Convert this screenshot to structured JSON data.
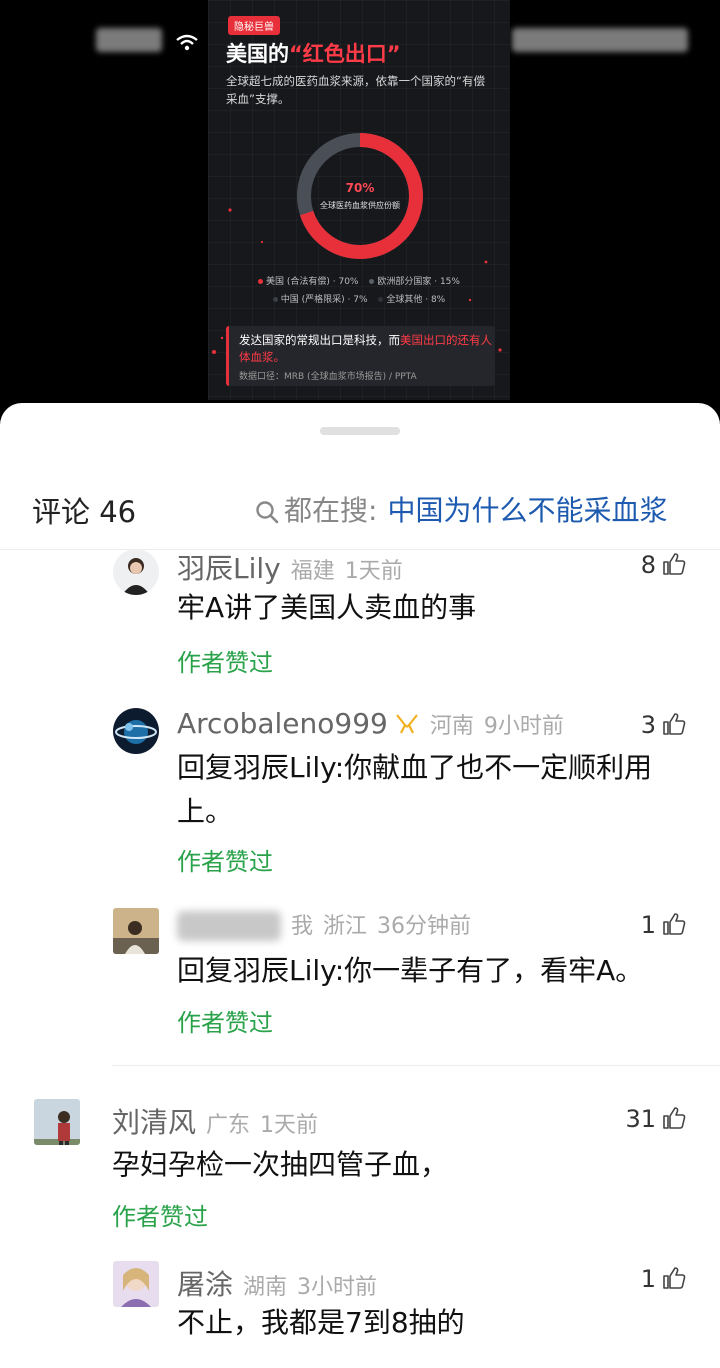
{
  "poster": {
    "tag": "隐秘巨兽",
    "title_plain": "美国的",
    "title_red": "“红色出口”",
    "subtitle": "全球超七成的医药血浆来源，依靠一个国家的“有偿采血”支撑。",
    "donut_value": "70%",
    "donut_label": "全球医药血浆供应份额",
    "share": [
      70,
      15,
      7,
      8
    ],
    "legend_row1": [
      {
        "text": "美国 (合法有偿) · 70%",
        "color": "#e8303a"
      },
      {
        "text": "欧洲部分国家 · 15%",
        "color": "#5a5f68"
      }
    ],
    "legend_row2": [
      {
        "text": "中国 (严格限采) · 7%",
        "color": "#3b3f46"
      },
      {
        "text": "全球其他 · 8%",
        "color": "#2e3137"
      }
    ],
    "note_text": "发达国家的常规出口是科技，而",
    "note_red": "美国出口的还有人体血浆。",
    "note_source": "数据口径：MRB (全球血浆市场报告) / PPTA",
    "colors": {
      "accent": "#e8303a",
      "ring_gray": "#4a4e56"
    }
  },
  "sheet": {
    "comments_label": "评论 46",
    "search_prefix": "都在搜:",
    "search_term": "中国为什么不能采血浆"
  },
  "comments": [
    {
      "user": "羽辰Lily",
      "location": "福建",
      "time": "1天前",
      "likes": "8",
      "text": "牢A讲了美国人卖血的事",
      "author_liked": "作者赞过"
    },
    {
      "user": "Arcobaleno999",
      "location": "河南",
      "time": "9小时前",
      "likes": "3",
      "text": "回复羽辰Lily:你献血了也不一定顺利用上。",
      "author_liked": "作者赞过"
    },
    {
      "user": "",
      "me_label": "我",
      "location": "浙江",
      "time": "36分钟前",
      "likes": "1",
      "text": "回复羽辰Lily:你一辈子有了，看牢A。",
      "author_liked": "作者赞过"
    },
    {
      "user": "刘清风",
      "location": "广东",
      "time": "1天前",
      "likes": "31",
      "text": "孕妇孕检一次抽四管子血，",
      "author_liked": "作者赞过"
    },
    {
      "user": "屠涂",
      "location": "湖南",
      "time": "3小时前",
      "likes": "1",
      "text": "不止，我都是7到8抽的"
    }
  ],
  "icons": [
    "wifi-icon",
    "search-icon",
    "thumb-up-icon",
    "medal-icon"
  ]
}
